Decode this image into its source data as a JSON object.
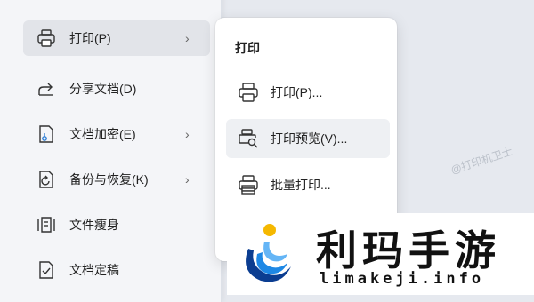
{
  "main_menu": {
    "items": [
      {
        "label": "打印(P)",
        "icon": "printer-icon",
        "chevron": "›"
      },
      {
        "label": "分享文档(D)",
        "icon": "share-icon"
      },
      {
        "label": "文档加密(E)",
        "icon": "encrypt-document-icon",
        "chevron": "›"
      },
      {
        "label": "备份与恢复(K)",
        "icon": "backup-restore-icon",
        "chevron": "›"
      },
      {
        "label": "文件瘦身",
        "icon": "file-slim-icon"
      },
      {
        "label": "文档定稿",
        "icon": "finalize-document-icon"
      }
    ]
  },
  "submenu": {
    "title": "打印",
    "items": [
      {
        "label": "打印(P)...",
        "icon": "printer-icon"
      },
      {
        "label": "打印预览(V)...",
        "icon": "print-preview-icon"
      },
      {
        "label": "批量打印...",
        "icon": "batch-print-icon"
      }
    ]
  },
  "watermark": {
    "text": "@打印机卫士"
  },
  "logo": {
    "main_text": "利玛手游",
    "sub_text": "limakeji.info",
    "colors": {
      "yellow": "#f5b800",
      "blue": "#1e88e5",
      "dark_blue": "#0b3d91"
    }
  }
}
